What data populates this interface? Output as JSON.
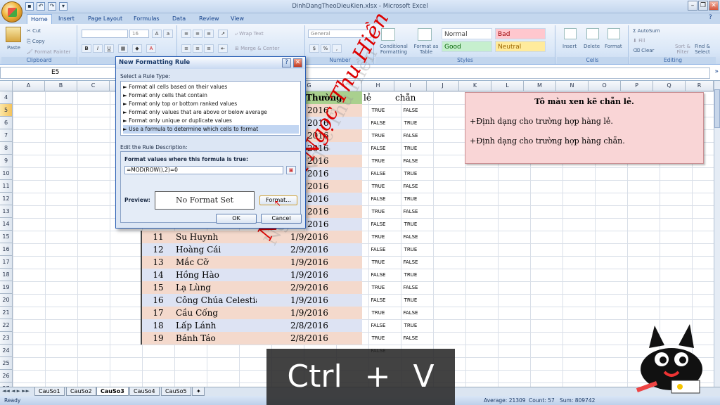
{
  "window": {
    "title": "DinhDangTheoDieuKien.xlsx - Microsoft Excel"
  },
  "ribbon": {
    "tabs": [
      "Home",
      "Insert",
      "Page Layout",
      "Formulas",
      "Data",
      "Review",
      "View"
    ],
    "clipboard": {
      "paste": "Paste",
      "cut": "Cut",
      "copy": "Copy",
      "format_painter": "Format Painter",
      "label": "Clipboard"
    },
    "font": {
      "size": "16"
    },
    "alignment": {
      "wrap": "Wrap Text",
      "merge": "Merge & Center"
    },
    "number": {
      "format": "General",
      "label": "Number"
    },
    "styles": {
      "conditional": "Conditional Formatting",
      "format_table": "Format as Table",
      "normal": "Normal",
      "bad": "Bad",
      "good": "Good",
      "neutral": "Neutral",
      "label": "Styles"
    },
    "cells": {
      "insert": "Insert",
      "delete": "Delete",
      "format": "Format",
      "label": "Cells"
    },
    "editing": {
      "autosum": "AutoSum",
      "fill": "Fill",
      "clear": "Clear",
      "sort": "Sort & Filter",
      "find": "Find & Select",
      "label": "Editing"
    }
  },
  "formula_bar": {
    "name_box": "E5"
  },
  "columns": [
    "A",
    "B",
    "C",
    "D",
    "E",
    "F",
    "G",
    "H",
    "I",
    "J",
    "K",
    "L",
    "M",
    "N",
    "O",
    "P",
    "Q",
    "R"
  ],
  "rows": [
    "4",
    "5",
    "6",
    "7",
    "8",
    "9",
    "10",
    "11",
    "12",
    "13",
    "14",
    "15",
    "16",
    "17",
    "18",
    "19",
    "20",
    "21",
    "22",
    "23",
    "24",
    "25",
    "26",
    "27"
  ],
  "table": {
    "header_g": "Thường",
    "header_h": "lẻ",
    "header_i": "chẵn",
    "dates_top": [
      "2016",
      "2016",
      "2016",
      "2016",
      "2016",
      "2016",
      "2016",
      "2016",
      "2016",
      "2016"
    ],
    "rows": [
      {
        "n": "11",
        "name": "Su Huynh",
        "date": "1/9/2016"
      },
      {
        "n": "12",
        "name": "Hoàng Cái",
        "date": "2/9/2016"
      },
      {
        "n": "13",
        "name": "Mắc Cỡ",
        "date": "1/9/2016"
      },
      {
        "n": "14",
        "name": "Hồng Hào",
        "date": "1/9/2016"
      },
      {
        "n": "15",
        "name": "Lạ Lùng",
        "date": "2/9/2016"
      },
      {
        "n": "16",
        "name": "Công Chúa Celestia",
        "date": "1/9/2016"
      },
      {
        "n": "17",
        "name": "Cầu Cống",
        "date": "1/9/2016"
      },
      {
        "n": "18",
        "name": "Lấp Lánh",
        "date": "2/8/2016"
      },
      {
        "n": "19",
        "name": "Bánh Táo",
        "date": "2/8/2016"
      }
    ],
    "col_h": [
      "TRUE",
      "FALSE",
      "TRUE",
      "FALSE",
      "TRUE",
      "FALSE",
      "TRUE",
      "FALSE",
      "TRUE",
      "FALSE",
      "TRUE",
      "FALSE",
      "TRUE",
      "FALSE",
      "TRUE",
      "FALSE",
      "TRUE",
      "FALSE",
      "TRUE",
      "FALSE"
    ],
    "col_i": [
      "FALSE",
      "TRUE",
      "FALSE",
      "TRUE",
      "FALSE",
      "TRUE",
      "FALSE",
      "TRUE",
      "FALSE",
      "TRUE",
      "FALSE",
      "TRUE",
      "FALSE",
      "TRUE",
      "FALSE",
      "TRUE",
      "FALSE",
      "TRUE",
      "FALSE"
    ]
  },
  "note": {
    "title": "Tô  màu xen kẽ chẵn lẻ.",
    "line1": "+Định dạng cho trường hợp hàng lẻ.",
    "line2": "+Định dạng cho trường hợp hàng chẵn."
  },
  "dialog": {
    "title": "New Formatting Rule",
    "select_label": "Select a Rule Type:",
    "rule_types": [
      "► Format all cells based on their values",
      "► Format only cells that contain",
      "► Format only top or bottom ranked values",
      "► Format only values that are above or below average",
      "► Format only unique or duplicate values",
      "► Use a formula to determine which cells to format"
    ],
    "edit_label": "Edit the Rule Description:",
    "formula_label": "Format values where this formula is true:",
    "formula": "=MOD(ROW(),2)=0",
    "preview_label": "Preview:",
    "preview_text": "No Format Set",
    "format_btn": "Format...",
    "ok": "OK",
    "cancel": "Cancel"
  },
  "sheets": [
    "CauSo1",
    "CauSo2",
    "CauSo3",
    "CauSo4",
    "CauSo5"
  ],
  "status": {
    "ready": "Ready",
    "average": "Average: 21309",
    "count": "Count: 57",
    "sum": "Sum: 809742"
  },
  "overlay": {
    "keys": "Ctrl + V"
  },
  "watermark": "Nguyễn Ngọc Thu Hiền"
}
